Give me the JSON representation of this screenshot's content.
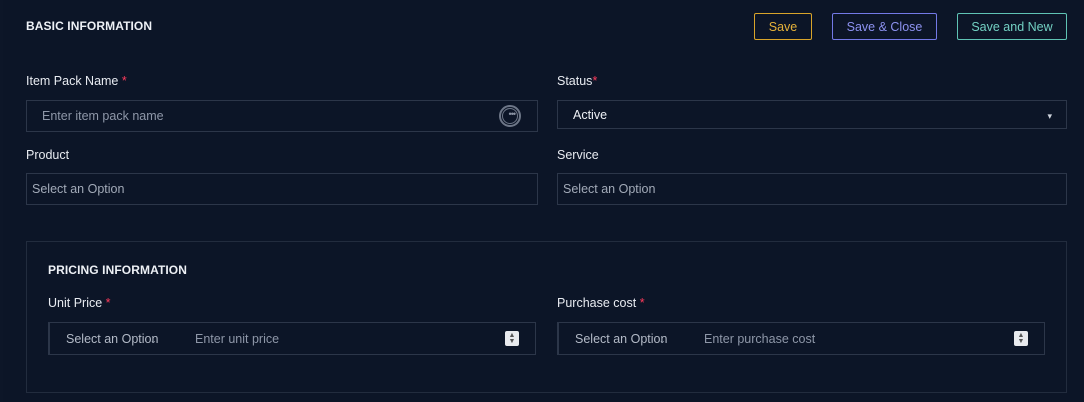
{
  "basic": {
    "title": "BASIC INFORMATION",
    "buttons": {
      "save": "Save",
      "save_close": "Save & Close",
      "save_new": "Save and New"
    },
    "item_pack_name": {
      "label": "Item Pack Name",
      "required": "*",
      "placeholder": "Enter item pack name"
    },
    "status": {
      "label": "Status",
      "required": "*",
      "value": "Active"
    },
    "product": {
      "label": "Product",
      "placeholder": "Select an Option"
    },
    "service": {
      "label": "Service",
      "placeholder": "Select an Option"
    }
  },
  "pricing": {
    "title": "PRICING INFORMATION",
    "unit_price": {
      "label": "Unit Price",
      "required": "*",
      "select_placeholder": "Select an Option",
      "input_placeholder": "Enter unit price"
    },
    "purchase_cost": {
      "label": "Purchase cost",
      "required": "*",
      "select_placeholder": "Select an Option",
      "input_placeholder": "Enter purchase cost"
    }
  },
  "colors": {
    "background": "#0c1527",
    "save": "#e6b23a",
    "save_close": "#8d92f0",
    "save_new": "#73d1c3",
    "required": "#ff3b5c"
  },
  "icons": {
    "field_assist": "more-horizontal-circle-icon",
    "status_dropdown": "chevron-down-icon",
    "stepper": "up-down-stepper-icon"
  }
}
